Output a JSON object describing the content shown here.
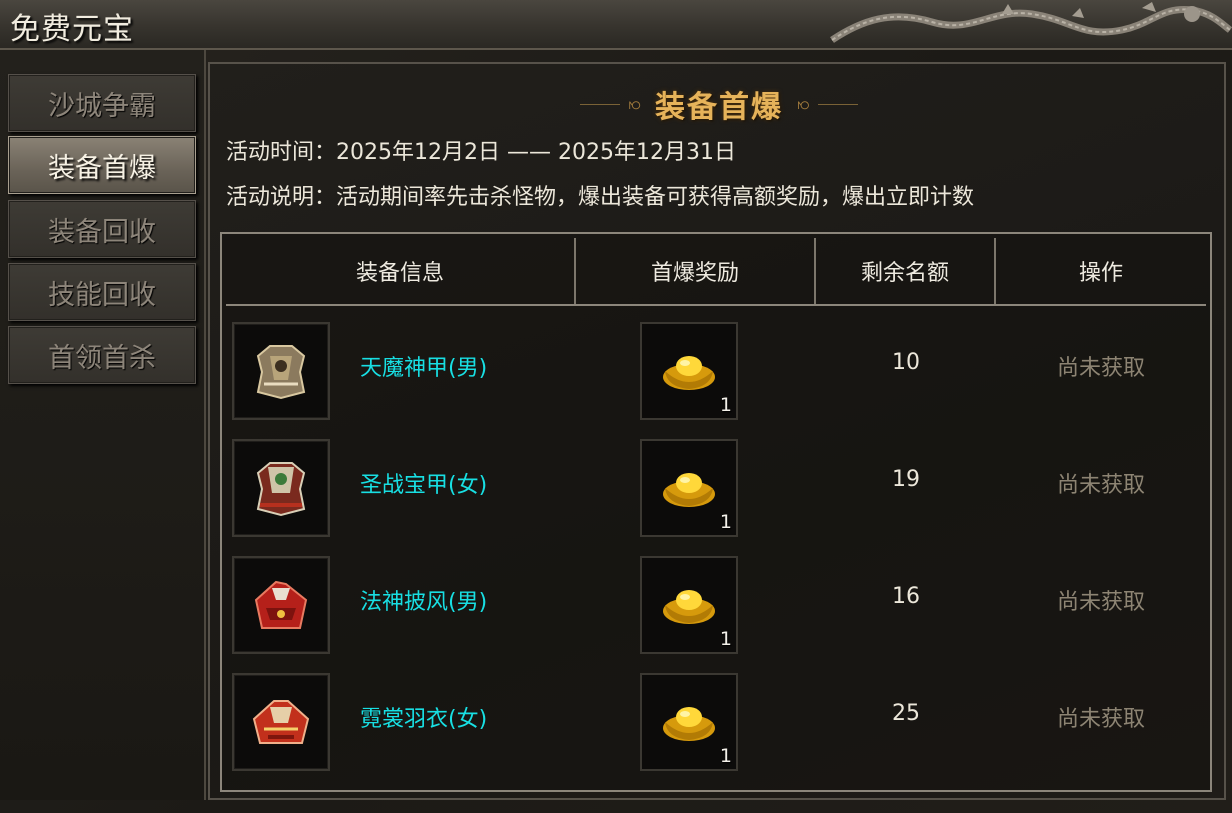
{
  "window": {
    "title": "免费元宝"
  },
  "sidebar": {
    "items": [
      {
        "label": "沙城争霸",
        "active": false
      },
      {
        "label": "装备首爆",
        "active": true
      },
      {
        "label": "装备回收",
        "active": false
      },
      {
        "label": "技能回收",
        "active": false
      },
      {
        "label": "首领首杀",
        "active": false
      }
    ]
  },
  "main": {
    "title": "装备首爆",
    "time_line": "活动时间：2025年12月2日 —— 2025年12月31日",
    "desc_line": "活动说明：活动期间率先击杀怪物，爆出装备可获得高额奖励，爆出立即计数",
    "table": {
      "headers": [
        "装备信息",
        "首爆奖励",
        "剩余名额",
        "操作"
      ],
      "rows": [
        {
          "item_name": "天魔神甲(男)",
          "item_icon": "armor-icon",
          "reward_icon": "gold-ingot-icon",
          "reward_count": "1",
          "remaining": "10",
          "status": "尚未获取"
        },
        {
          "item_name": "圣战宝甲(女)",
          "item_icon": "armor-icon",
          "reward_icon": "gold-ingot-icon",
          "reward_count": "1",
          "remaining": "19",
          "status": "尚未获取"
        },
        {
          "item_name": "法神披风(男)",
          "item_icon": "cloak-icon",
          "reward_icon": "gold-ingot-icon",
          "reward_count": "1",
          "remaining": "16",
          "status": "尚未获取"
        },
        {
          "item_name": "霓裳羽衣(女)",
          "item_icon": "robe-icon",
          "reward_icon": "gold-ingot-icon",
          "reward_count": "1",
          "remaining": "25",
          "status": "尚未获取"
        }
      ]
    }
  },
  "colors": {
    "item_name": "#18dfe3",
    "title_gold": "#e6b35a",
    "status_inactive": "#8d8473"
  }
}
